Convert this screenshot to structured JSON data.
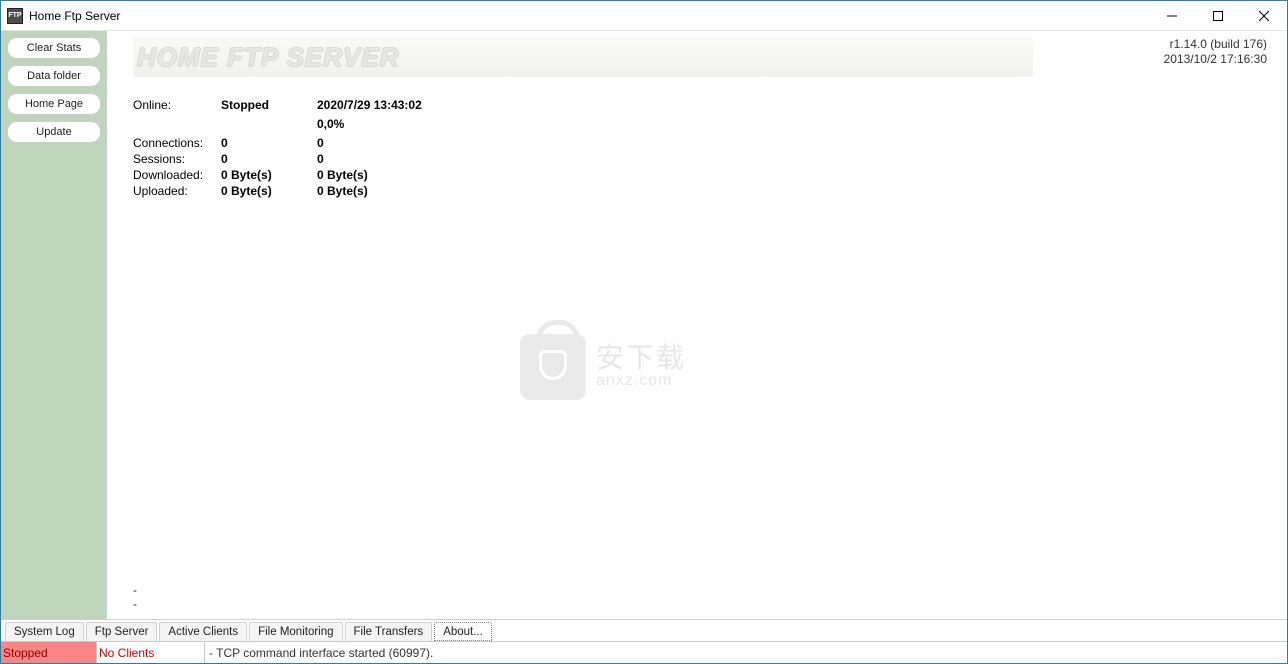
{
  "window": {
    "title": "Home Ftp Server"
  },
  "version": {
    "line1": "r1.14.0 (build 176)",
    "line2": "2013/10/2 17:16:30"
  },
  "banner": {
    "title": "HOME FTP SERVER"
  },
  "sidebar": {
    "buttons": [
      {
        "name": "clear-stats-button",
        "label": "Clear Stats"
      },
      {
        "name": "data-folder-button",
        "label": "Data folder"
      },
      {
        "name": "home-page-button",
        "label": "Home Page"
      },
      {
        "name": "update-button",
        "label": "Update"
      }
    ]
  },
  "stats": {
    "online_label": "Online:",
    "online_status": "Stopped",
    "online_time": "2020/7/29 13:43:02",
    "percent": "0,0%",
    "rows": [
      {
        "label": "Connections:",
        "v1": "0",
        "v2": "0"
      },
      {
        "label": "Sessions:",
        "v1": "0",
        "v2": "0"
      },
      {
        "label": "Downloaded:",
        "v1": "0 Byte(s)",
        "v2": "0 Byte(s)"
      },
      {
        "label": "Uploaded:",
        "v1": "0 Byte(s)",
        "v2": "0 Byte(s)"
      }
    ],
    "dash1": "-",
    "dash2": "-"
  },
  "watermark": {
    "cn": "安下载",
    "url": "anxz.com"
  },
  "tabs": [
    {
      "name": "tab-system-log",
      "label": "System Log",
      "active": false
    },
    {
      "name": "tab-ftp-server",
      "label": "Ftp Server",
      "active": false
    },
    {
      "name": "tab-active-clients",
      "label": "Active Clients",
      "active": false
    },
    {
      "name": "tab-file-monitoring",
      "label": "File Monitoring",
      "active": false
    },
    {
      "name": "tab-file-transfers",
      "label": "File Transfers",
      "active": false
    },
    {
      "name": "tab-about",
      "label": "About...",
      "active": true
    }
  ],
  "status": {
    "stopped": "Stopped",
    "clients": "No Clients",
    "message": "- TCP command interface started (60997)."
  }
}
